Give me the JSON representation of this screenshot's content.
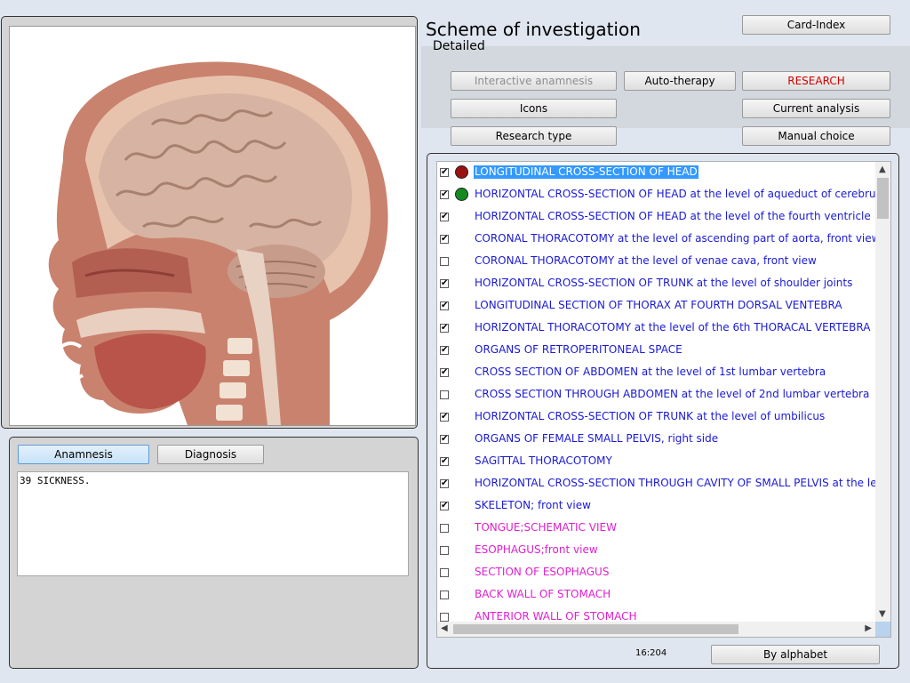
{
  "header": {
    "title": "Scheme of investigation",
    "subtitle": "Detailed"
  },
  "toolbar": {
    "card_index": "Card-Index",
    "interactive_anamnesis": "Interactive anamnesis",
    "auto_therapy": "Auto-therapy",
    "research": "RESEARCH",
    "icons": "Icons",
    "current_analysis": "Current analysis",
    "research_type": "Research type",
    "manual_choice": "Manual choice"
  },
  "notes": {
    "tab_anamnesis": "Anamnesis",
    "tab_diagnosis": "Diagnosis",
    "text": "39 SICKNESS."
  },
  "list": {
    "items": [
      {
        "label": "LONGITUDINAL CROSS-SECTION OF HEAD",
        "checked": true,
        "marker": "#9b1212"
      },
      {
        "label": "HORIZONTAL CROSS-SECTION OF HEAD at the level of aqueduct of cerebrum",
        "checked": true,
        "marker": "#138a1f"
      },
      {
        "label": "HORIZONTAL CROSS-SECTION OF HEAD at the level of the fourth ventricle",
        "checked": true
      },
      {
        "label": "CORONAL THORACOTOMY at the level of ascending part of aorta, front view",
        "checked": true
      },
      {
        "label": "CORONAL THORACOTOMY at the level of venae cava, front view",
        "checked": false
      },
      {
        "label": "HORIZONTAL CROSS-SECTION OF TRUNK at the level of shoulder joints",
        "checked": true
      },
      {
        "label": "LONGITUDINAL  SECTION  OF  THORAX  AT  FOURTH  DORSAL  VENTEBRA",
        "checked": true
      },
      {
        "label": "HORIZONTAL THORACOTOMY at the level of the 6th THORACAL VERTEBRA",
        "checked": true
      },
      {
        "label": "ORGANS OF RETROPERITONEAL SPACE",
        "checked": true
      },
      {
        "label": "CROSS SECTION OF ABDOMEN at the level of 1st lumbar vertebra",
        "checked": true
      },
      {
        "label": "CROSS SECTION THROUGH ABDOMEN at the level of 2nd lumbar vertebra",
        "checked": false
      },
      {
        "label": "HORIZONTAL CROSS-SECTION OF TRUNK at the level of umbilicus",
        "checked": true
      },
      {
        "label": "ORGANS OF FEMALE SMALL PELVIS, right side",
        "checked": true
      },
      {
        "label": "SAGITTAL THORACOTOMY",
        "checked": true
      },
      {
        "label": "HORIZONTAL CROSS-SECTION THROUGH CAVITY OF SMALL PELVIS at the leve",
        "checked": true
      },
      {
        "label": "SKELETON;  front  view",
        "checked": true
      },
      {
        "label": "TONGUE;SCHEMATIC VIEW",
        "checked": false,
        "pink": true
      },
      {
        "label": "ESOPHAGUS;front view",
        "checked": false,
        "pink": true
      },
      {
        "label": "SECTION OF ESOPHAGUS",
        "checked": false,
        "pink": true
      },
      {
        "label": "BACK WALL OF STOMACH",
        "checked": false,
        "pink": true
      },
      {
        "label": "ANTERIOR  WALL  OF  STOMACH",
        "checked": false,
        "pink": true
      }
    ],
    "counter": "16:204",
    "sort_button": "By alphabet"
  },
  "colors": {
    "item_blue": "#1a1ad6",
    "item_pink": "#e020d0",
    "selection": "#3399ff",
    "research_red": "#d10000"
  }
}
